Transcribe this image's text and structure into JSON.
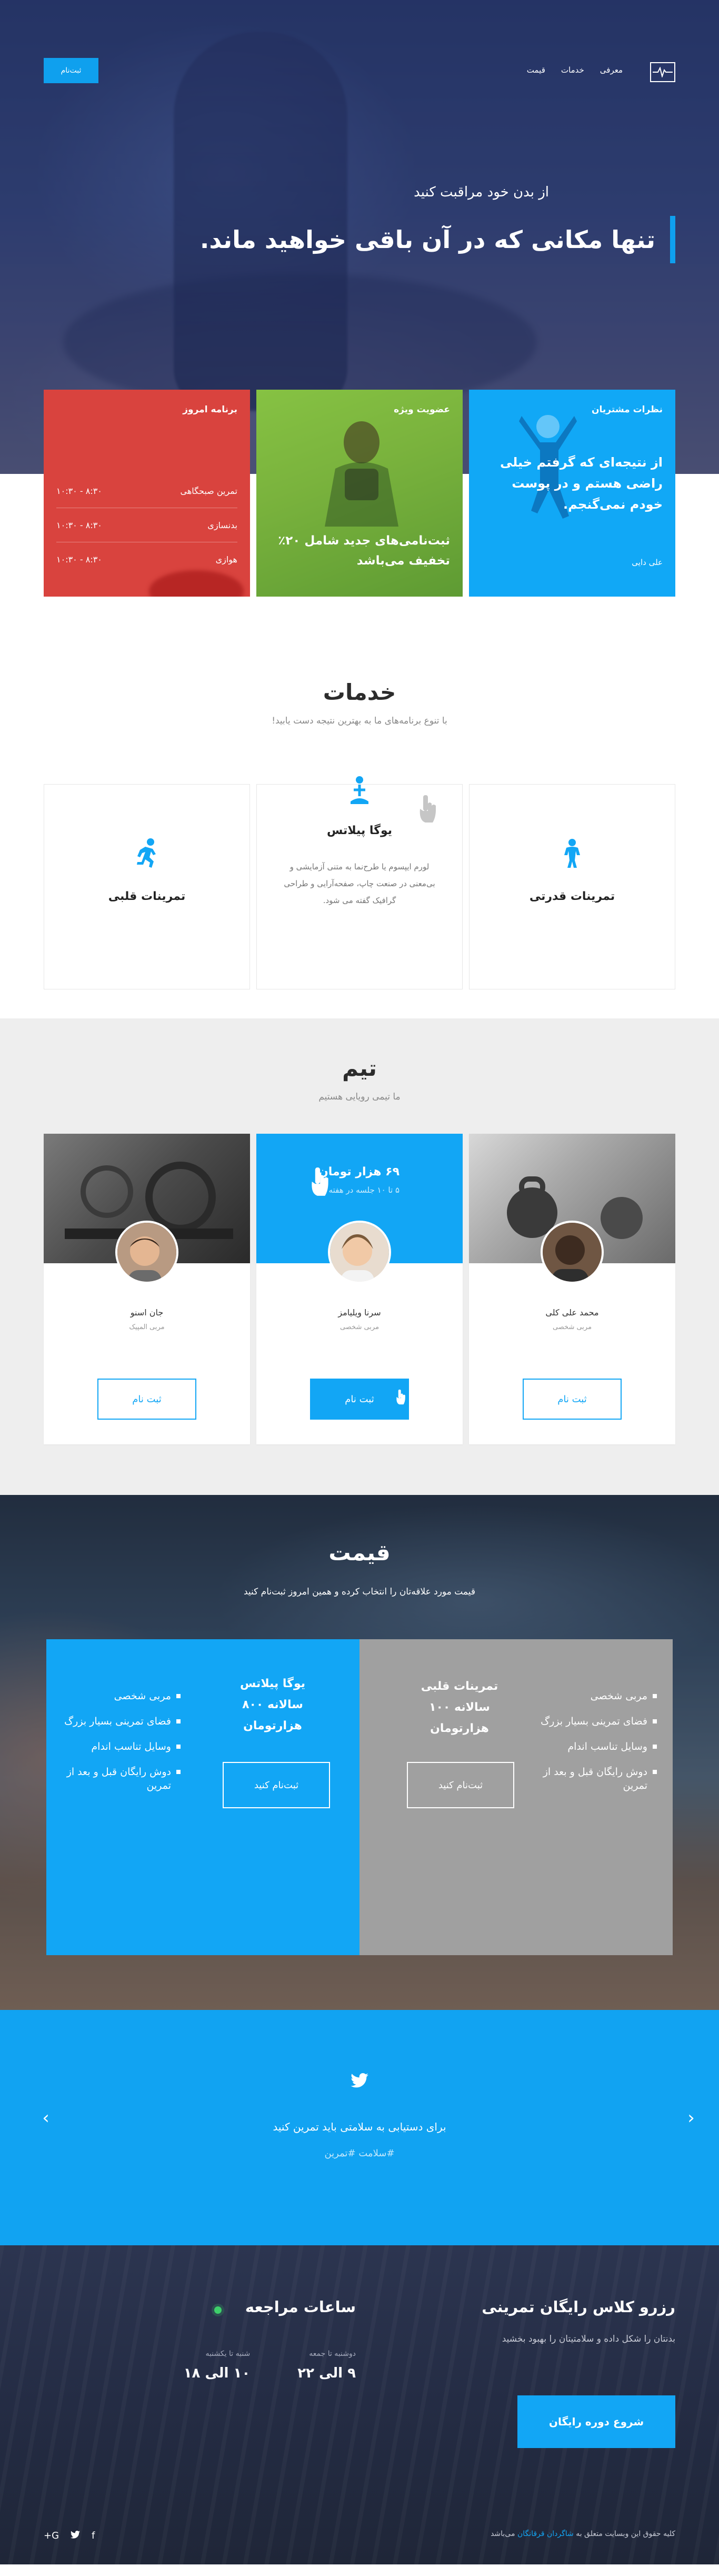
{
  "nav": {
    "links": [
      "معرفی",
      "خدمات",
      "قیمت"
    ],
    "signup": "ثبت‌نام"
  },
  "hero": {
    "subtitle": "از بدن خود مراقبت کنید",
    "title": "تنها مکانی که در آن باقی خواهید ماند."
  },
  "cards": {
    "testimonials": {
      "title": "نظرات مشتریان",
      "quote": "از نتیجه‌ای که گرفتم خیلی راضی هستم و در پوست خودم نمی‌گنجم.",
      "author": "علی دایی"
    },
    "special": {
      "title": "عضویت ویژه",
      "offer": "ثبت‌نامی‌های جدید شامل ۲۰٪ تخفیف می‌باشد"
    },
    "schedule": {
      "title": "برنامه امروز",
      "rows": [
        {
          "name": "تمرین صبحگاهی",
          "time": "۸:۳۰ - ۱۰:۳۰"
        },
        {
          "name": "بدنسازی",
          "time": "۸:۳۰ - ۱۰:۳۰"
        },
        {
          "name": "هوازی",
          "time": "۸:۳۰ - ۱۰:۳۰"
        }
      ]
    }
  },
  "services": {
    "title": "خدمات",
    "subtitle": "با تنوع برنامه‌های ما به بهترین نتیجه دست یابید!",
    "items": [
      {
        "name": "تمرینات قدرتی",
        "icon": "strength-icon"
      },
      {
        "name": "یوگا پیلاتس",
        "icon": "yoga-icon",
        "desc": "لورم ایپسوم یا طرح‌نما به متنی آزمایشی و بی‌معنی در صنعت چاپ، صفحه‌آرایی و طراحی گرافیک گفته می شود."
      },
      {
        "name": "تمرینات قلبی",
        "icon": "running-icon"
      }
    ]
  },
  "team": {
    "title": "تیم",
    "subtitle": "ما تیمی رویایی هستیم",
    "promo": {
      "price": "۶۹ هزار تومان",
      "sub": "۵ تا ۱۰ جلسه در هفته"
    },
    "members": [
      {
        "name": "محمد علی کلی",
        "role": "مربی شخصی",
        "button": "ثبت نام"
      },
      {
        "name": "سرنا ویلیامز",
        "role": "مربی شخصی",
        "button": "ثبت نام"
      },
      {
        "name": "جان اسنو",
        "role": "مربی المپیک",
        "button": "ثبت نام"
      }
    ]
  },
  "pricing": {
    "title": "قیمت",
    "subtitle": "قیمت مورد علاقه‌تان را انتخاب کرده و همین امروز ثبت‌نام کنید",
    "plans": [
      {
        "title": "تمرینات قلبی",
        "price": "سالانه ۱۰۰ هزارتومان",
        "features": [
          "مربی شخصی",
          "فضای تمرینی بسیار بزرگ",
          "وسایل تناسب اندام",
          "دوش رایگان قبل و بعد از تمرین"
        ],
        "button": "ثبت‌نام کنید"
      },
      {
        "title": "یوگا پیلاتس",
        "price": "سالانه ۸۰۰ هزارتومان",
        "features": [
          "مربی شخصی",
          "فضای تمرینی بسیار بزرگ",
          "وسایل تناسب اندام",
          "دوش رایگان قبل و بعد از تمرین"
        ],
        "button": "ثبت‌نام کنید"
      }
    ]
  },
  "twitter": {
    "text": "برای دستیابی به سلامتی باید تمرین کنید",
    "hashtags": "#سلامت #تمرین"
  },
  "footer": {
    "reserve_title": "رزرو کلاس رایگان تمرینی",
    "reserve_sub": "بدنتان را شکل داده و سلامتیتان را بهبود بخشید",
    "reserve_button": "شروع دوره رایگان",
    "hours_title": "ساعات مراجعه",
    "hours": [
      {
        "days": "دوشنبه تا جمعه",
        "time": "۹ الی ۲۲"
      },
      {
        "days": "شنبه تا یکشنبه",
        "time": "۱۰ الی ۱۸"
      }
    ],
    "copyright_prefix": "کلیه حقوق این وبسایت متعلق به",
    "copyright_link": "شاگردان قرقانگان",
    "copyright_suffix": "می‌باشد",
    "socials": [
      "facebook-icon",
      "twitter-icon",
      "google-plus-icon"
    ]
  },
  "colors": {
    "accent": "#12a6f5",
    "green": "#7ab33d",
    "red": "#d9433e",
    "grey_plan": "#a0a0a0",
    "footer": "#242c44",
    "status_online": "#3ecf6a"
  }
}
